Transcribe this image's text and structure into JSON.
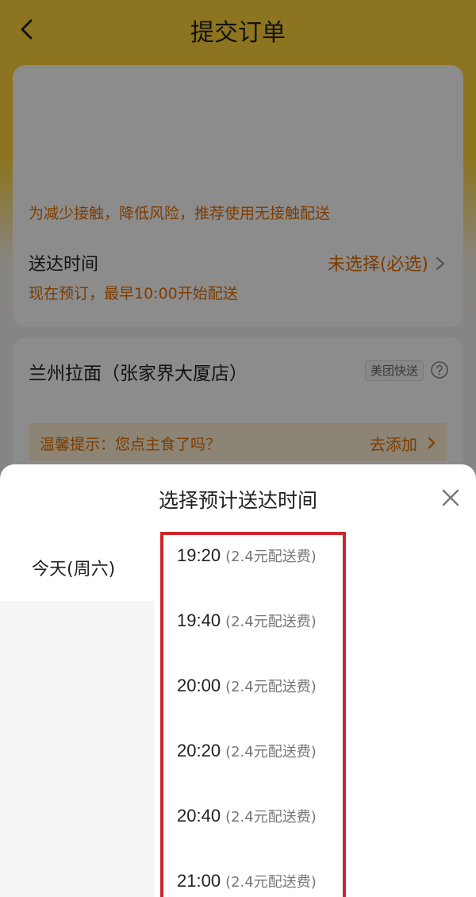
{
  "header": {
    "title": "提交订单"
  },
  "delivery_card": {
    "notice": "为减少接触，降低风险，推荐使用无接触配送",
    "delivery_time_label": "送达时间",
    "delivery_time_value": "未选择(必选)",
    "delivery_time_sub": "现在预订，最早10:00开始配送"
  },
  "store_card": {
    "store_name": "兰州拉面（张家界大厦店）",
    "badge": "美团快送",
    "tip_text": "温馨提示：您点主食了吗？",
    "tip_action": "去添加"
  },
  "time_sheet": {
    "title": "选择预计送达时间",
    "days": [
      {
        "label": "今天(周六)"
      }
    ],
    "slots": [
      {
        "time": "19:20",
        "fee": "(2.4元配送费)"
      },
      {
        "time": "19:40",
        "fee": "(2.4元配送费)"
      },
      {
        "time": "20:00",
        "fee": "(2.4元配送费)"
      },
      {
        "time": "20:20",
        "fee": "(2.4元配送费)"
      },
      {
        "time": "20:40",
        "fee": "(2.4元配送费)"
      },
      {
        "time": "21:00",
        "fee": "(2.4元配送费)"
      }
    ]
  },
  "colors": {
    "brand_yellow": "#ffd43b",
    "accent_orange": "#e46d00",
    "highlight_red": "#d0262a"
  }
}
